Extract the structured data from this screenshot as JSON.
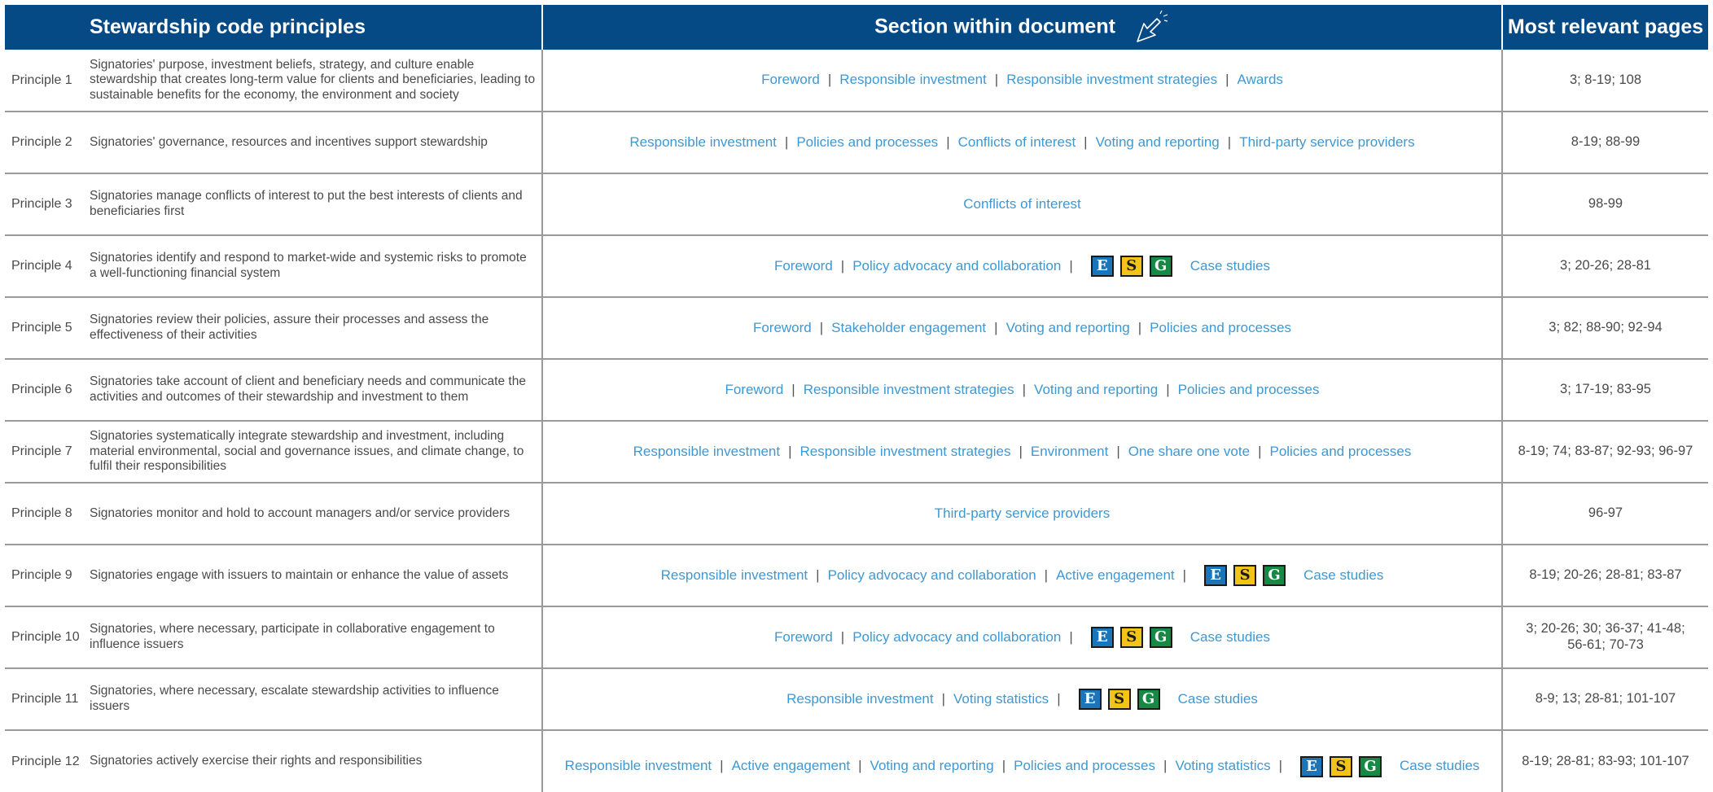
{
  "header": {
    "principles": "Stewardship code principles",
    "section": "Section within document",
    "pages": "Most relevant pages"
  },
  "colors": {
    "header_bg": "#064a85",
    "link": "#3d98d3",
    "text": "#4a4a4a",
    "badge_e": "#1b75bb",
    "badge_s": "#f2c418",
    "badge_g": "#168a45"
  },
  "icons": {
    "header_icon": "cursor-pointer-icon"
  },
  "esg_badges": {
    "e": "E",
    "s": "S",
    "g": "G"
  },
  "rows": [
    {
      "num": "Principle 1",
      "desc": "Signatories' purpose, investment beliefs, strategy, and culture enable stewardship that creates long-term value for clients and beneficiaries, leading to sustainable benefits for the economy, the environment and society",
      "links": [
        "Foreword",
        "Responsible investment",
        "Responsible investment strategies",
        "Awards"
      ],
      "esg": false,
      "after": "",
      "pages": "3; 8-19; 108"
    },
    {
      "num": "Principle 2",
      "desc": "Signatories' governance, resources and incentives support stewardship",
      "links": [
        "Responsible investment",
        "Policies and processes",
        "Conflicts of interest",
        "Voting and reporting",
        "Third-party service providers"
      ],
      "esg": false,
      "after": "",
      "pages": "8-19; 88-99"
    },
    {
      "num": "Principle 3",
      "desc": "Signatories manage conflicts of interest to put the best interests of clients and beneficiaries first",
      "links": [
        "Conflicts of interest"
      ],
      "esg": false,
      "after": "",
      "pages": "98-99"
    },
    {
      "num": "Principle 4",
      "desc": "Signatories identify and respond to market-wide and systemic risks to promote a well-functioning financial system",
      "links": [
        "Foreword",
        "Policy advocacy and collaboration"
      ],
      "esg": true,
      "after": "Case studies",
      "pages": "3; 20-26; 28-81"
    },
    {
      "num": "Principle 5",
      "desc": "Signatories review their policies, assure their processes and assess the effectiveness of their activities",
      "links": [
        "Foreword",
        "Stakeholder engagement",
        "Voting and reporting",
        "Policies and processes"
      ],
      "esg": false,
      "after": "",
      "pages": "3; 82; 88-90; 92-94"
    },
    {
      "num": "Principle 6",
      "desc": "Signatories take account of client and beneficiary needs and communicate the activities and outcomes of their stewardship and investment to them",
      "links": [
        "Foreword",
        "Responsible investment strategies",
        "Voting and reporting",
        "Policies and processes"
      ],
      "esg": false,
      "after": "",
      "pages": "3; 17-19; 83-95"
    },
    {
      "num": "Principle 7",
      "desc": "Signatories systematically integrate stewardship and investment, including material environmental, social and governance issues, and climate change, to fulfil their responsibilities",
      "links": [
        "Responsible investment",
        "Responsible investment strategies",
        "Environment",
        "One share one vote",
        "Policies and processes"
      ],
      "esg": false,
      "after": "",
      "pages": "8-19; 74; 83-87; 92-93; 96-97"
    },
    {
      "num": "Principle 8",
      "desc": "Signatories monitor and hold to account managers and/or service providers",
      "links": [
        "Third-party service providers"
      ],
      "esg": false,
      "after": "",
      "pages": "96-97"
    },
    {
      "num": "Principle 9",
      "desc": "Signatories engage with issuers to maintain or enhance the value of assets",
      "links": [
        "Responsible investment",
        "Policy advocacy and collaboration",
        "Active engagement"
      ],
      "esg": true,
      "after": "Case studies",
      "pages": "8-19; 20-26; 28-81; 83-87"
    },
    {
      "num": "Principle 10",
      "desc": "Signatories, where necessary, participate in collaborative engagement to influence issuers",
      "links": [
        "Foreword",
        "Policy advocacy and collaboration"
      ],
      "esg": true,
      "after": "Case studies",
      "pages": "3; 20-26; 30; 36-37; 41-48; 56-61; 70-73"
    },
    {
      "num": "Principle 11",
      "desc": "Signatories, where necessary, escalate stewardship activities to influence issuers",
      "links": [
        "Responsible investment",
        "Voting statistics"
      ],
      "esg": true,
      "after": "Case studies",
      "pages": "8-9; 13; 28-81; 101-107"
    },
    {
      "num": "Principle 12",
      "desc": "Signatories actively exercise their rights and responsibilities",
      "links": [
        "Responsible investment",
        "Active engagement",
        "Voting and reporting",
        "Policies and processes",
        "Voting statistics"
      ],
      "esg": true,
      "after": "Case studies",
      "pages": "8-19; 28-81; 83-93; 101-107"
    }
  ]
}
